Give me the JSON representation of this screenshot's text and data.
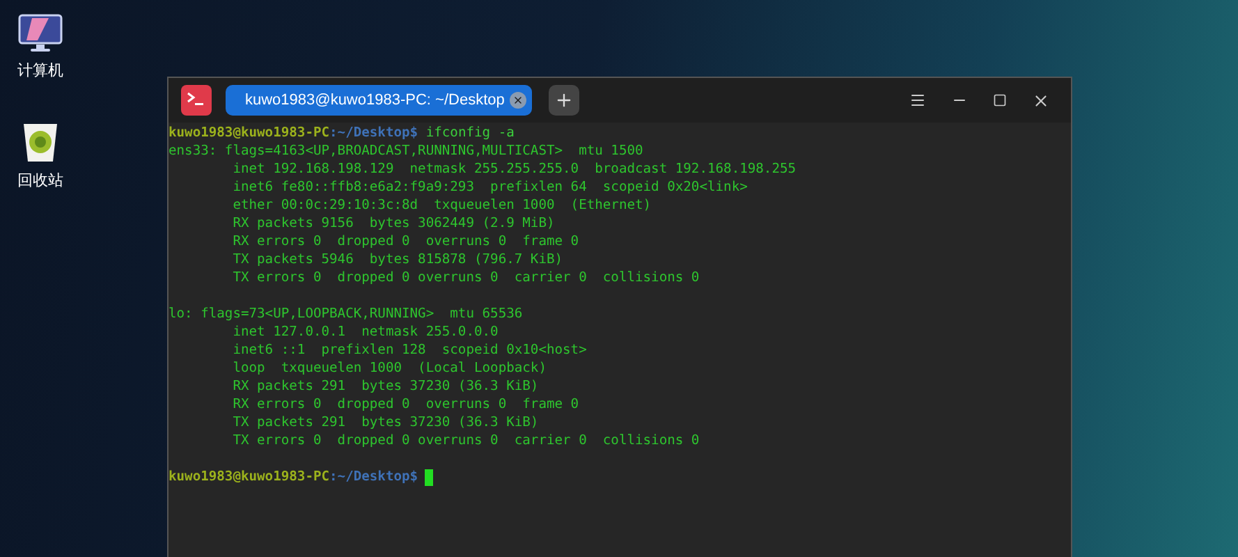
{
  "desktop_icons": [
    {
      "label": "计算机",
      "kind": "computer"
    },
    {
      "label": "回收站",
      "kind": "trash"
    }
  ],
  "terminal": {
    "tabs": [
      {
        "label": "kuwo1983@kuwo1983-PC: ~/Desktop",
        "selected": true
      }
    ],
    "lines": [
      {
        "kind": "prompt",
        "user_host": "kuwo1983@kuwo1983-PC",
        "path": ":~/Desktop$",
        "command": "ifconfig -a",
        "cursor": false
      },
      {
        "kind": "output",
        "text": "ens33: flags=4163<UP,BROADCAST,RUNNING,MULTICAST>  mtu 1500"
      },
      {
        "kind": "output",
        "text": "        inet 192.168.198.129  netmask 255.255.255.0  broadcast 192.168.198.255"
      },
      {
        "kind": "output",
        "text": "        inet6 fe80::ffb8:e6a2:f9a9:293  prefixlen 64  scopeid 0x20<link>"
      },
      {
        "kind": "output",
        "text": "        ether 00:0c:29:10:3c:8d  txqueuelen 1000  (Ethernet)"
      },
      {
        "kind": "output",
        "text": "        RX packets 9156  bytes 3062449 (2.9 MiB)"
      },
      {
        "kind": "output",
        "text": "        RX errors 0  dropped 0  overruns 0  frame 0"
      },
      {
        "kind": "output",
        "text": "        TX packets 5946  bytes 815878 (796.7 KiB)"
      },
      {
        "kind": "output",
        "text": "        TX errors 0  dropped 0 overruns 0  carrier 0  collisions 0"
      },
      {
        "kind": "blank"
      },
      {
        "kind": "output",
        "text": "lo: flags=73<UP,LOOPBACK,RUNNING>  mtu 65536"
      },
      {
        "kind": "output",
        "text": "        inet 127.0.0.1  netmask 255.0.0.0"
      },
      {
        "kind": "output",
        "text": "        inet6 ::1  prefixlen 128  scopeid 0x10<host>"
      },
      {
        "kind": "output",
        "text": "        loop  txqueuelen 1000  (Local Loopback)"
      },
      {
        "kind": "output",
        "text": "        RX packets 291  bytes 37230 (36.3 KiB)"
      },
      {
        "kind": "output",
        "text": "        RX errors 0  dropped 0  overruns 0  frame 0"
      },
      {
        "kind": "output",
        "text": "        TX packets 291  bytes 37230 (36.3 KiB)"
      },
      {
        "kind": "output",
        "text": "        TX errors 0  dropped 0 overruns 0  carrier 0  collisions 0"
      },
      {
        "kind": "blank"
      },
      {
        "kind": "prompt",
        "user_host": "kuwo1983@kuwo1983-PC",
        "path": ":~/Desktop$",
        "cursor": true
      }
    ]
  }
}
